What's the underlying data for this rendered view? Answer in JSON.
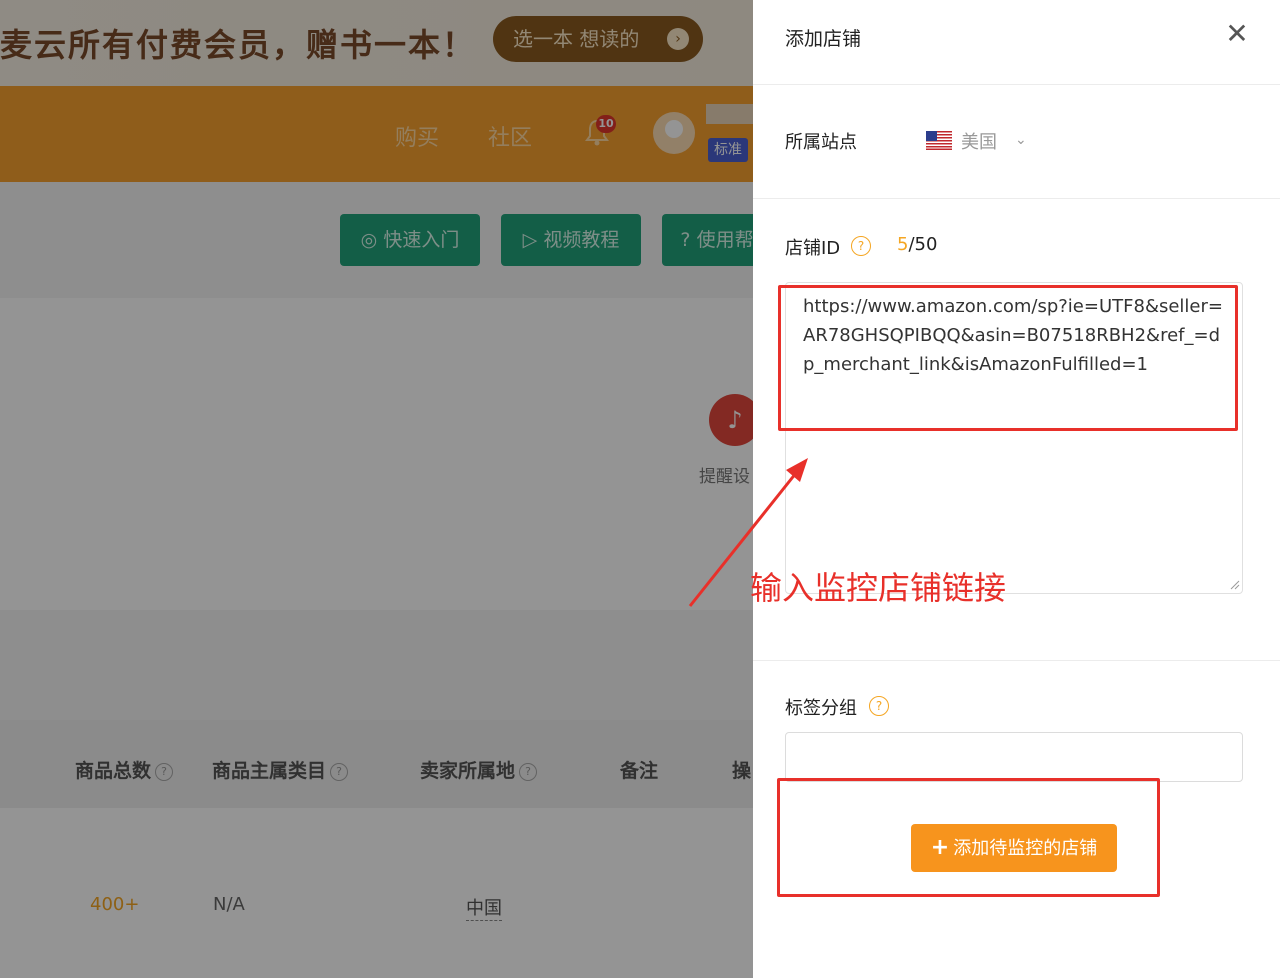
{
  "background": {
    "banner": {
      "text": "麦云所有付费会员，赠书一本！",
      "button": "选一本 想读的",
      "button_icon": "chevron-right-icon"
    },
    "nav": {
      "links": [
        "购买",
        "社区"
      ],
      "notification_count": "10",
      "user_tier": "标准"
    },
    "quick_buttons": [
      "快速入门",
      "视频教程",
      "使用帮"
    ],
    "remind": {
      "label": "提醒设"
    },
    "table": {
      "headers": [
        "商品总数",
        "商品主属类目",
        "卖家所属地",
        "备注",
        "操"
      ],
      "row": {
        "total": "400+",
        "category": "N/A",
        "location": "中国"
      }
    }
  },
  "drawer": {
    "title": "添加店铺",
    "close_icon": "close-icon",
    "site": {
      "label": "所属站点",
      "value": "美国",
      "flag_icon": "us-flag-icon"
    },
    "store_id": {
      "label": "店铺ID",
      "count_current": "5",
      "count_max": "/50"
    },
    "store_links": "https://www.amazon.com/sp?ie=UTF8&seller=AR78GHSQPIBQQ&asin=B07518RBH2&ref_=dp_merchant_link&isAmazonFulfilled=1",
    "tag_group": {
      "label": "标签分组",
      "value": ""
    },
    "add_button": "添加待监控的店铺"
  },
  "annotation": {
    "text": "输入监控店铺链接"
  },
  "colors": {
    "accent": "#f7941d",
    "nav": "#f7a030",
    "green": "#21a37a",
    "highlight": "#e8302a"
  }
}
